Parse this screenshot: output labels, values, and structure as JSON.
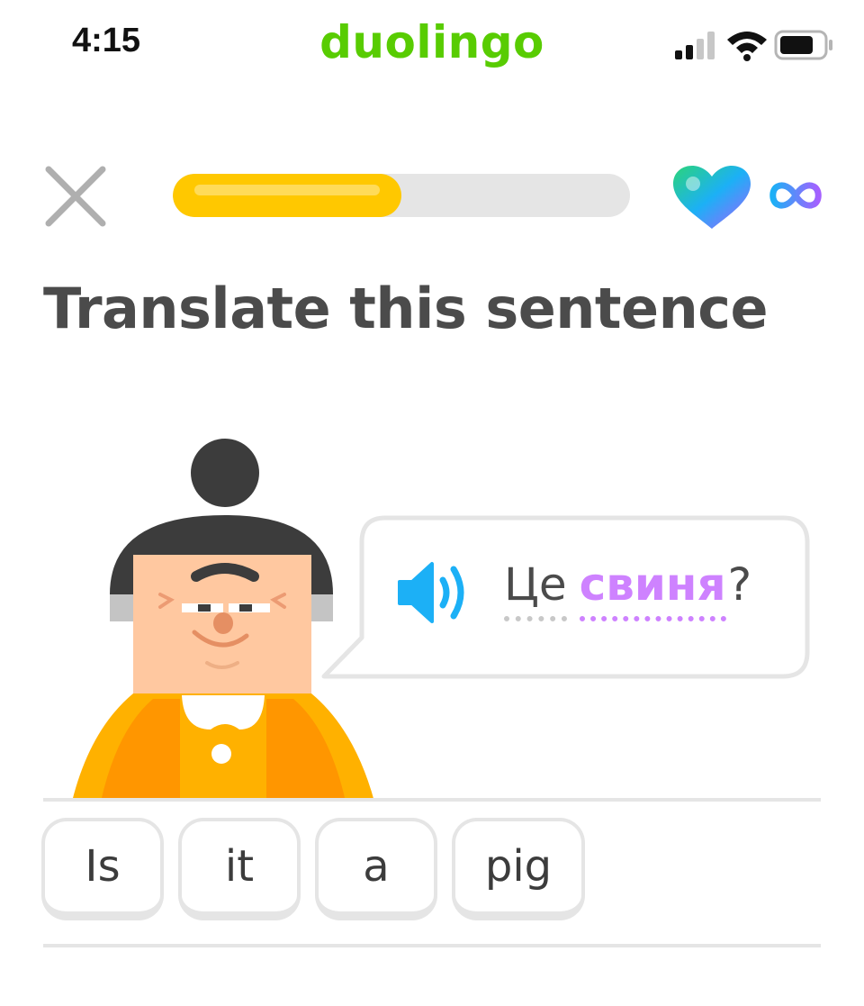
{
  "status_bar": {
    "time": "4:15",
    "brand": "duolingo"
  },
  "header": {
    "close_icon": "close-icon",
    "progress": 0.5,
    "hearts_icon": "heart-icon",
    "hearts_count": "∞"
  },
  "title": "Translate this sentence",
  "prompt": {
    "speaker_icon": "speaker-icon",
    "words": [
      "Це",
      "свиня",
      "?"
    ]
  },
  "answer_chips": [
    "Is",
    "it",
    "a",
    "pig"
  ],
  "colors": {
    "brand": "#58cc02",
    "progress": "#ffc800",
    "highlight_word": "#ce82ff",
    "speaker": "#1cb0f6",
    "title": "#4b4b4b"
  }
}
